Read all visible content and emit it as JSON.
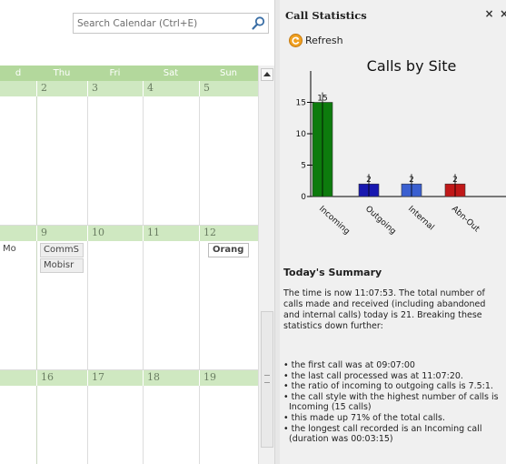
{
  "search": {
    "placeholder": "Search Calendar (Ctrl+E)"
  },
  "calendar": {
    "weekdays": [
      "d",
      "Thu",
      "Fri",
      "Sat",
      "Sun"
    ],
    "weeks": [
      [
        "",
        "2",
        "3",
        "4",
        "5"
      ],
      [
        "",
        "9",
        "10",
        "11",
        "12"
      ],
      [
        "",
        "16",
        "17",
        "18",
        "19"
      ]
    ],
    "appointments": [
      {
        "text": "Mo"
      },
      {
        "text": "CommS"
      },
      {
        "text": "Mobisr"
      },
      {
        "text": "Orang"
      }
    ]
  },
  "stats_pane": {
    "title": "Call Statistics",
    "close": "×",
    "close2": "×",
    "refresh_label": "Refresh"
  },
  "chart_data": {
    "type": "bar",
    "title": "Calls by Site",
    "categories": [
      "Incoming",
      "Outgoing",
      "Internal",
      "Abn-Out"
    ],
    "values": [
      15,
      2,
      2,
      2
    ],
    "data_labels": [
      "15",
      "2",
      "2",
      "2"
    ],
    "colors": [
      "#0d7b0d",
      "#1818b0",
      "#3a5fd0",
      "#c01818"
    ],
    "ylim": [
      0,
      20
    ],
    "yticks": [
      0,
      5,
      10,
      15
    ],
    "xlabel": "",
    "ylabel": "",
    "grid": false
  },
  "summary": {
    "heading": "Today's Summary",
    "text": "The time is now 11:07:53. The total number of calls made and received (including abandoned and internal calls) today is 21. Breaking these statistics down further:",
    "items": [
      "the first call was at 09:07:00",
      "the last call processed was at 11:07:20.",
      "the ratio of incoming to outgoing calls is 7.5:1.",
      "the call style with the highest number of calls is Incoming (15 calls)",
      "this made up 71% of the total calls.",
      "the longest call recorded is an Incoming call (duration was 00:03:15)"
    ]
  }
}
